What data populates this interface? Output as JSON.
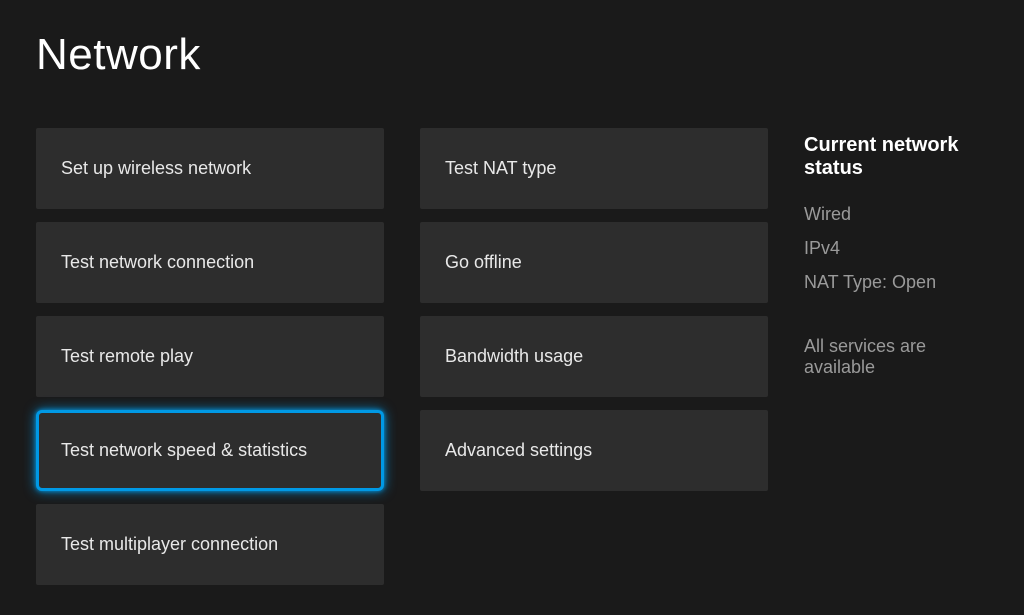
{
  "page": {
    "title": "Network"
  },
  "column1": {
    "items": [
      {
        "label": "Set up wireless network",
        "selected": false
      },
      {
        "label": "Test network connection",
        "selected": false
      },
      {
        "label": "Test remote play",
        "selected": false
      },
      {
        "label": "Test network speed & statistics",
        "selected": true
      },
      {
        "label": "Test multiplayer connection",
        "selected": false
      }
    ]
  },
  "column2": {
    "items": [
      {
        "label": "Test NAT type",
        "selected": false
      },
      {
        "label": "Go offline",
        "selected": false
      },
      {
        "label": "Bandwidth usage",
        "selected": false
      },
      {
        "label": "Advanced settings",
        "selected": false
      }
    ]
  },
  "status": {
    "title": "Current network status",
    "lines": [
      "Wired",
      "IPv4",
      "NAT Type: Open"
    ],
    "services": "All services are available"
  }
}
